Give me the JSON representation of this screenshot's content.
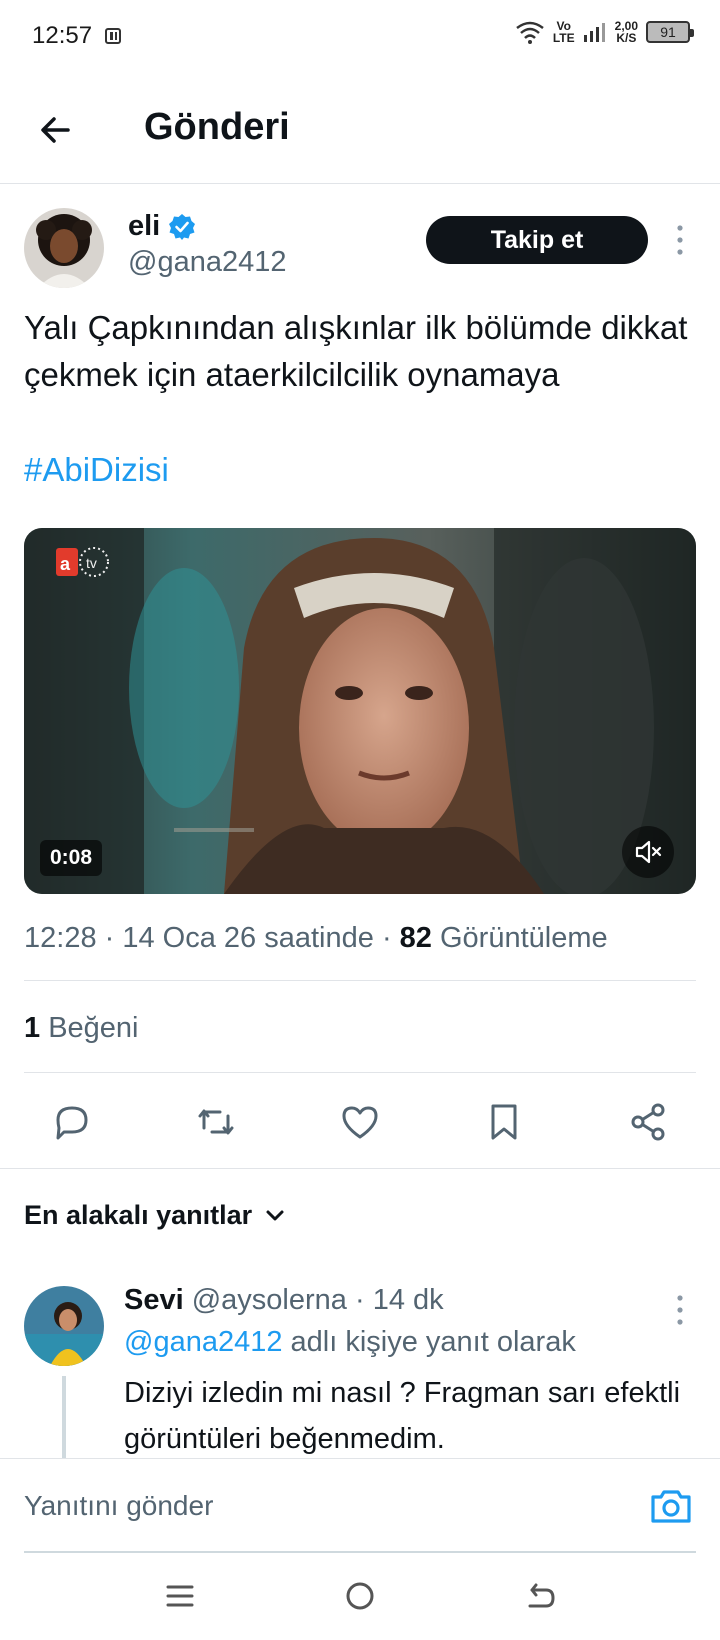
{
  "status": {
    "time": "12:57",
    "network_top": "Vo",
    "network_bottom": "LTE",
    "speed_top": "2,00",
    "speed_bottom": "K/S",
    "battery": "91"
  },
  "header": {
    "title": "Gönderi"
  },
  "post": {
    "author_name": "eli",
    "author_handle": "@gana2412",
    "follow_label": "Takip et",
    "text": "Yalı Çapkınından alışkınlar ilk bölümde dikkat çekmek için ataerkilcilcilik oynamaya",
    "hashtag": "#AbiDizisi",
    "video_duration": "0:08",
    "time": "12:28",
    "date": "14 Oca 26 saatinde",
    "views_count": "82",
    "views_label": "Görüntüleme",
    "likes_count": "1",
    "likes_label": "Beğeni"
  },
  "replies": {
    "sort_label": "En alakalı yanıtlar",
    "items": [
      {
        "name": "Sevi",
        "handle": "@aysolerna",
        "time": "14 dk",
        "reply_to_mention": "@gana2412",
        "reply_to_suffix": "adlı kişiye yanıt olarak",
        "text": "Diziyi izledin mi nasıl ? Fragman sarı efektli görüntüleri beğenmedim."
      }
    ]
  },
  "compose": {
    "placeholder": "Yanıtını gönder"
  },
  "colors": {
    "accent": "#1d9bf0",
    "text_primary": "#0f1419",
    "text_secondary": "#536471"
  },
  "icons": {
    "back": "arrow-left-icon",
    "verified": "verified-badge-icon",
    "more": "more-vertical-icon",
    "reply": "reply-icon",
    "retweet": "retweet-icon",
    "like": "heart-icon",
    "bookmark": "bookmark-icon",
    "share": "share-icon",
    "camera": "camera-icon",
    "mute": "speaker-muted-icon"
  }
}
